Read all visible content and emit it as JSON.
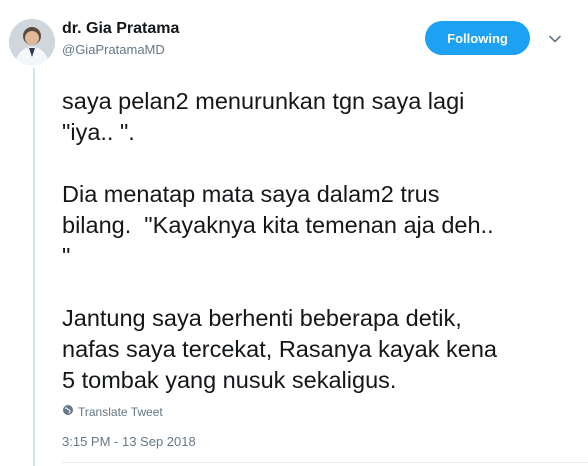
{
  "author": {
    "name": "dr. Gia Pratama",
    "handle": "@GiaPratamaMD"
  },
  "actions": {
    "follow_label": "Following",
    "menu_icon": "chevron-down-icon"
  },
  "tweet": {
    "text": "saya pelan2 menurunkan tgn saya lagi\n\"iya.. \".\n\nDia menatap mata saya dalam2 trus\nbilang.  \"Kayaknya kita temenan aja deh..\n\"\n\nJantung saya berhenti beberapa detik,\nnafas saya tercekat, Rasanya kayak kena\n5 tombak yang nusuk sekaligus.",
    "translate_label": "Translate Tweet",
    "timestamp": "3:15 PM - 13 Sep 2018"
  },
  "colors": {
    "accent": "#1da1f2",
    "secondary_text": "#657786",
    "thread_line": "#cce6f7"
  }
}
